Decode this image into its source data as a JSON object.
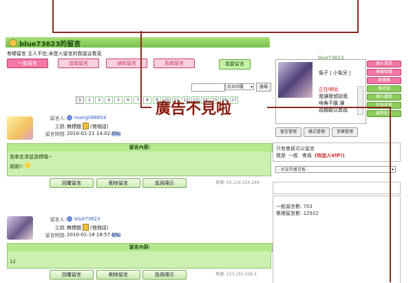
{
  "ad_top_label": "blue73623",
  "page_title": "blue73623的留言",
  "notice": "有哪留言 主人不在;未登入留言的我留這看見",
  "tabs": [
    {
      "label": "一般留言",
      "active": true
    },
    {
      "label": "追蹤留言",
      "active": false
    },
    {
      "label": "通知留言",
      "active": false
    },
    {
      "label": "系統留言",
      "active": false
    }
  ],
  "my_messages_button": "我要留言",
  "search": {
    "placeholder": "",
    "select_value": "尚未回覆",
    "button": "搜尋"
  },
  "pager": [
    "1",
    "2",
    "3",
    "4",
    "5",
    "6",
    "7",
    "8",
    "9",
    "10",
    "11",
    "12",
    "13",
    "14",
    "15",
    "16",
    "17"
  ],
  "annotation": "廣告不見啦",
  "entries": [
    {
      "labels": {
        "author": "留言人:",
        "subject": "主題:",
        "time": "留言時間:"
      },
      "author": "roangli88654",
      "subject": "無標題",
      "subject_extra": "(悄悄話)",
      "time": "2010-01-21 14:02:59",
      "report": "檢舉",
      "content_head": "留言內容:",
      "content": [
        "我拿走滑鼠游標囉~",
        "謝謝!!"
      ],
      "buttons": [
        "回覆留言",
        "刪除留言",
        "設爲隱示"
      ],
      "source": "來源: 59.116.150.249"
    },
    {
      "labels": {
        "author": "留言人:",
        "subject": "主題:",
        "time": "留言時間:"
      },
      "author": "blue73623",
      "subject": "無標題",
      "subject_extra": "(悄悄話)",
      "time": "2010-01-18 18:57:18",
      "report": "檢舉",
      "content_head": "留言內容:",
      "content": [
        "12"
      ],
      "buttons": [
        "回覆留言",
        "刪除留言",
        "設爲隱示"
      ],
      "source": "來源: 123.193.206.3"
    }
  ],
  "profile": {
    "name": "兔子 | 小兔兒 |",
    "status_label": "正在嘀咕:",
    "status_text": [
      "我讓我傾談我",
      "喚角不腦  讓",
      "孤獨罷以其孤"
    ]
  },
  "side_buttons": [
    "個人資訊",
    "專屬相簿",
    "部落格",
    "留言版",
    "個人檔案",
    "好友名單",
    "最新影片"
  ],
  "manage_buttons": [
    "留言管理",
    "樣式管理",
    "音樂管理"
  ],
  "member_notice": {
    "line1": "只有會員可以留言",
    "line2_prefix": "我是",
    "line2_mid": "一般",
    "line2_member": "會員",
    "vip": "(快加入VIP!)"
  },
  "friend_select": "- 好友的留言板 -",
  "stats": {
    "general": "一般留言數: 703",
    "total": "累積留言數: 12922"
  },
  "colors": {
    "green": "#78c04a",
    "pink": "#f277a6",
    "annotation": "#8b1a10"
  }
}
